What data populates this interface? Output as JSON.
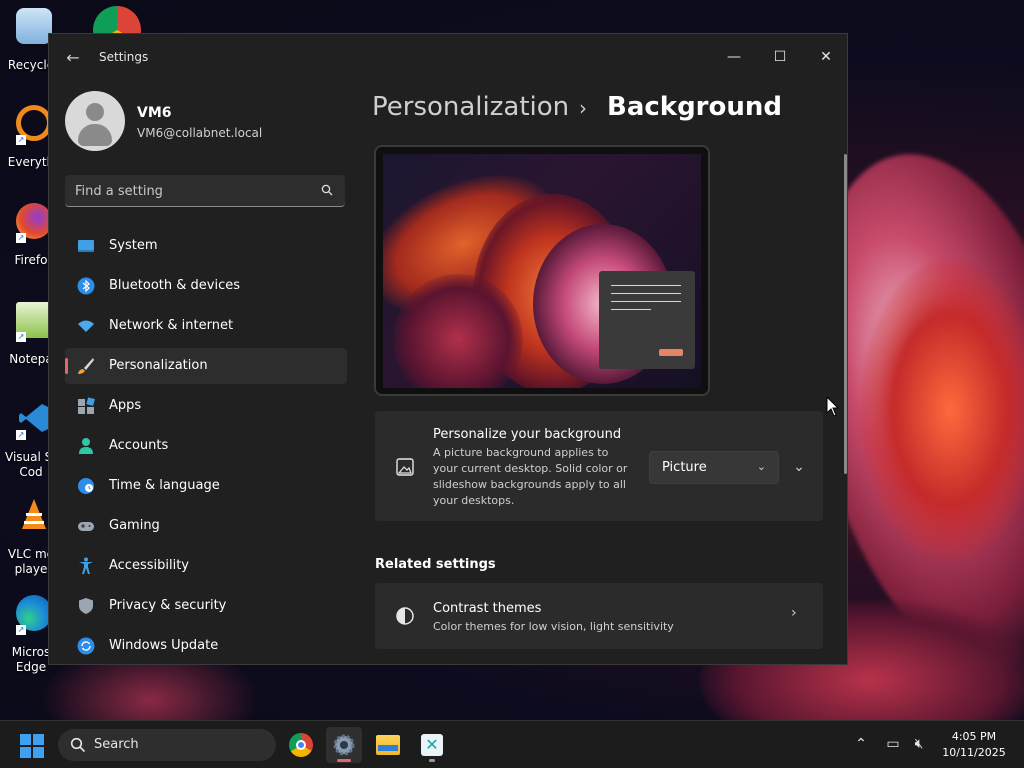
{
  "desktop": {
    "icons": [
      {
        "label": "Recycle",
        "icon": "recycle-bin-icon"
      },
      {
        "label": "Everyth",
        "icon": "everything-search-icon"
      },
      {
        "label": "Firefo",
        "icon": "firefox-icon"
      },
      {
        "label": "Notepa",
        "icon": "notepad-plus-plus-icon"
      },
      {
        "label": "Visual St\nCod",
        "icon": "vscode-icon"
      },
      {
        "label": "VLC me\nplaye",
        "icon": "vlc-icon"
      },
      {
        "label": "Micros\nEdge",
        "icon": "edge-icon"
      }
    ]
  },
  "window": {
    "title": "Settings",
    "controls": {
      "minimize": "—",
      "maximize": "☐",
      "close": "✕"
    }
  },
  "profile": {
    "name": "VM6",
    "email": "VM6@collabnet.local"
  },
  "search": {
    "placeholder": "Find a setting"
  },
  "nav": {
    "items": [
      {
        "label": "System",
        "icon": "system-icon"
      },
      {
        "label": "Bluetooth & devices",
        "icon": "bluetooth-icon"
      },
      {
        "label": "Network & internet",
        "icon": "wifi-icon"
      },
      {
        "label": "Personalization",
        "icon": "brush-icon",
        "active": true
      },
      {
        "label": "Apps",
        "icon": "apps-icon"
      },
      {
        "label": "Accounts",
        "icon": "accounts-icon"
      },
      {
        "label": "Time & language",
        "icon": "globe-clock-icon"
      },
      {
        "label": "Gaming",
        "icon": "gamepad-icon"
      },
      {
        "label": "Accessibility",
        "icon": "accessibility-icon"
      },
      {
        "label": "Privacy & security",
        "icon": "shield-icon"
      },
      {
        "label": "Windows Update",
        "icon": "update-icon"
      }
    ]
  },
  "breadcrumb": {
    "parent": "Personalization",
    "separator": "›",
    "current": "Background"
  },
  "background_card": {
    "title": "Personalize your background",
    "description_lines": [
      "A picture background applies to",
      "your current desktop. Solid color or",
      "slideshow backgrounds apply to all",
      "your desktops."
    ],
    "select_value": "Picture"
  },
  "related": {
    "heading": "Related settings",
    "contrast": {
      "title": "Contrast themes",
      "description": "Color themes for low vision, light sensitivity"
    }
  },
  "taskbar": {
    "search_label": "Search",
    "apps": [
      {
        "name": "chrome-taskbar-icon"
      },
      {
        "name": "settings-taskbar-icon",
        "active": true
      },
      {
        "name": "file-explorer-taskbar-icon"
      },
      {
        "name": "app-taskbar-icon"
      }
    ],
    "time": "4:05 PM",
    "date": "10/11/2025"
  },
  "colors": {
    "accent": "#e2666f",
    "window_bg": "#202020",
    "card_bg": "#2b2b2b"
  }
}
